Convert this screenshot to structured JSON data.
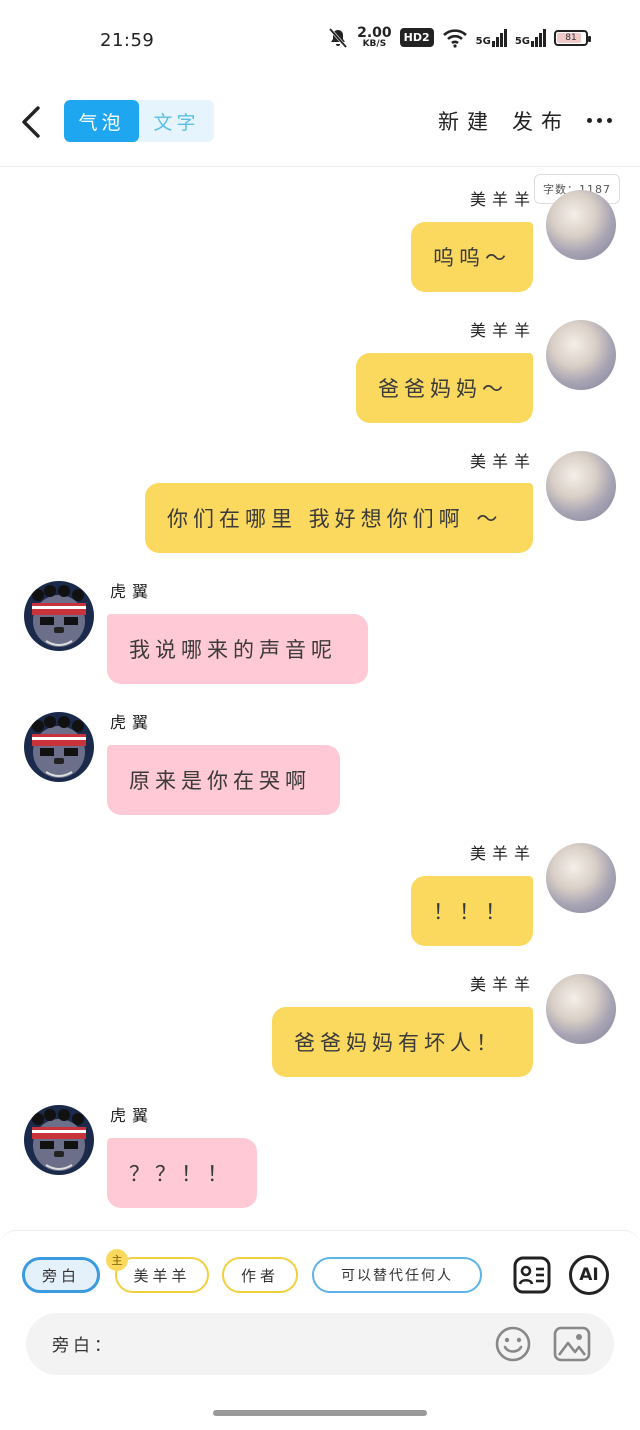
{
  "status_bar": {
    "time": "21:59",
    "speed_value": "2.00",
    "speed_unit": "KB/S",
    "hd_label": "HD2",
    "network_1": "5G",
    "network_2": "5G",
    "battery": "81"
  },
  "header": {
    "tab_bubble": "气泡",
    "tab_text": "文字",
    "new_label": "新建",
    "publish_label": "发布"
  },
  "word_count": "字数：1187",
  "messages": [
    {
      "speaker": "美羊羊",
      "text": "呜呜～"
    },
    {
      "speaker": "美羊羊",
      "text": "爸爸妈妈～"
    },
    {
      "speaker": "美羊羊",
      "text": "你们在哪里 我好想你们啊 ～"
    },
    {
      "speaker": "虎翼",
      "text": "我说哪来的声音呢"
    },
    {
      "speaker": "虎翼",
      "text": "原来是你在哭啊"
    },
    {
      "speaker": "美羊羊",
      "text": "！！！"
    },
    {
      "speaker": "美羊羊",
      "text": "爸爸妈妈有坏人！"
    },
    {
      "speaker": "虎翼",
      "text": "？？！！"
    }
  ],
  "roles": {
    "narration": "旁白",
    "host_badge": "主",
    "sheep": "美羊羊",
    "author": "作者",
    "anyone": "可以替代任何人"
  },
  "input": {
    "label": "旁白："
  },
  "ai_label": "AI",
  "colors": {
    "accent": "#1ea7f0",
    "right_bubble": "#fbd95f",
    "left_bubble": "#ffc9d6"
  }
}
